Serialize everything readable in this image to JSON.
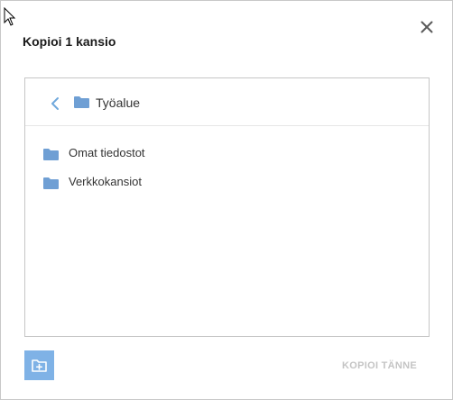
{
  "dialog": {
    "title": "Kopioi 1 kansio",
    "close_icon": "close-icon",
    "primary_button_label": "KOPIOI TÄNNE",
    "new_folder_icon": "new-folder-icon"
  },
  "browser": {
    "back_icon": "chevron-left-icon",
    "current_folder": "Työalue",
    "folders": [
      {
        "label": "Omat tiedostot",
        "icon": "folder-icon"
      },
      {
        "label": "Verkkokansiot",
        "icon": "folder-icon"
      }
    ]
  },
  "colors": {
    "accent": "#6fa8dc",
    "folder": "#6f9fd4",
    "new_folder_button": "#7fb2e6",
    "disabled_text": "#c4c4c4"
  }
}
